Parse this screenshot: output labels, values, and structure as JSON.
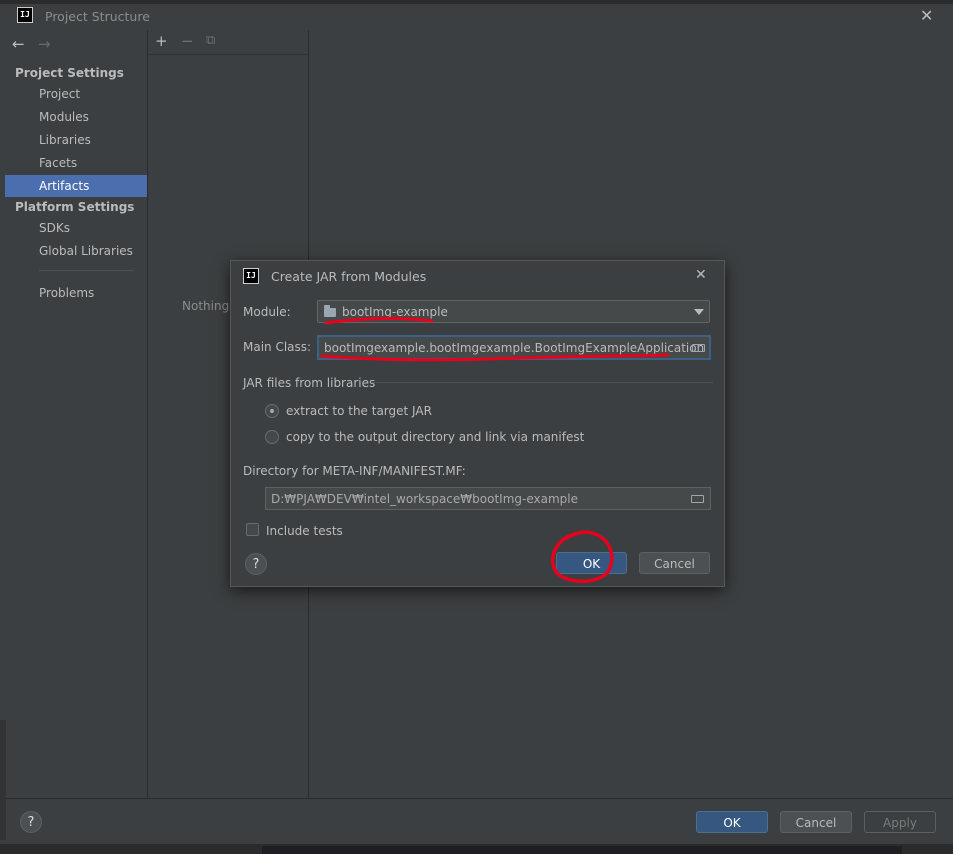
{
  "window": {
    "title": "Project Structure",
    "app_icon_text": "IJ",
    "close_glyph": "✕"
  },
  "sidebar": {
    "back_glyph": "←",
    "forward_glyph": "→",
    "project_settings_heading": "Project Settings",
    "project_settings_items": [
      {
        "label": "Project"
      },
      {
        "label": "Modules"
      },
      {
        "label": "Libraries"
      },
      {
        "label": "Facets"
      },
      {
        "label": "Artifacts",
        "selected": true
      }
    ],
    "platform_settings_heading": "Platform Settings",
    "platform_settings_items": [
      {
        "label": "SDKs"
      },
      {
        "label": "Global Libraries"
      }
    ],
    "problems_label": "Problems"
  },
  "artifacts_toolbar": {
    "add_glyph": "+",
    "remove_glyph": "−",
    "copy_glyph": "⧉"
  },
  "middle": {
    "empty_text": "Nothing"
  },
  "dialog": {
    "title": "Create JAR from Modules",
    "close_glyph": "✕",
    "module_label": "Module:",
    "module_value": "bootImg-example",
    "main_class_label": "Main Class:",
    "main_class_value": "bootImgexample.bootImgexample.BootImgExampleApplication",
    "jar_group_label": "JAR files from libraries",
    "radio_extract_label": "extract to the target JAR",
    "radio_copy_label": "copy to the output directory and link via manifest",
    "manifest_dir_label": "Directory for META-INF/MANIFEST.MF:",
    "manifest_dir_value": "D:₩PJA₩DEV₩intel_workspace₩bootImg-example",
    "include_tests_label": "Include tests",
    "help_glyph": "?",
    "ok_label": "OK",
    "cancel_label": "Cancel"
  },
  "footer": {
    "help_glyph": "?",
    "ok_label": "OK",
    "cancel_label": "Cancel",
    "apply_label": "Apply"
  },
  "colors": {
    "background": "#3c3f41",
    "selection": "#4b6eaf",
    "primary_button": "#365880",
    "annotation_red": "#e8001c"
  }
}
